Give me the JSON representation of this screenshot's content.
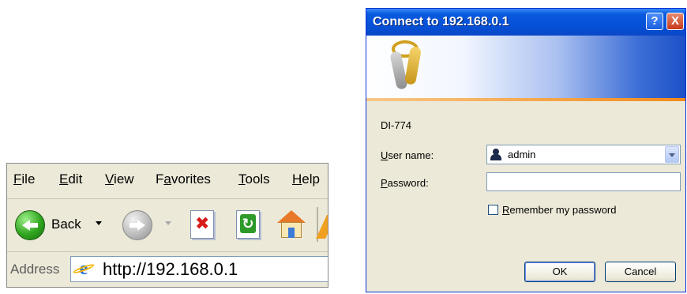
{
  "browser": {
    "menu": [
      {
        "pre": "",
        "ul": "F",
        "post": "ile"
      },
      {
        "pre": "",
        "ul": "E",
        "post": "dit"
      },
      {
        "pre": "",
        "ul": "V",
        "post": "iew"
      },
      {
        "pre": "F",
        "ul": "a",
        "post": "vorites"
      },
      {
        "pre": "",
        "ul": "T",
        "post": "ools"
      },
      {
        "pre": "",
        "ul": "H",
        "post": "elp"
      }
    ],
    "toolbar": {
      "back_label": "Back"
    },
    "address": {
      "label": "Address",
      "value": "http://192.168.0.1"
    }
  },
  "dialog": {
    "title": "Connect to 192.168.0.1",
    "help_glyph": "?",
    "close_glyph": "X",
    "realm": "DI-774",
    "username_label": {
      "ul": "U",
      "post": "ser name:"
    },
    "password_label": {
      "ul": "P",
      "post": "assword:"
    },
    "username_value": "admin",
    "password_value": "",
    "remember": {
      "ul": "R",
      "post": "emember my password",
      "checked": false
    },
    "ok_label": "OK",
    "cancel_label": "Cancel"
  },
  "colors": {
    "titlebar": "#0451d8",
    "dialog_bg": "#ece9d8",
    "accent_orange": "#f28a1a"
  },
  "icons": {
    "back": "back-arrow-icon",
    "forward": "forward-arrow-icon",
    "stop": "stop-icon",
    "refresh": "refresh-icon",
    "home": "home-icon",
    "address": "ie-page-icon",
    "banner": "keys-icon",
    "user": "user-icon"
  }
}
